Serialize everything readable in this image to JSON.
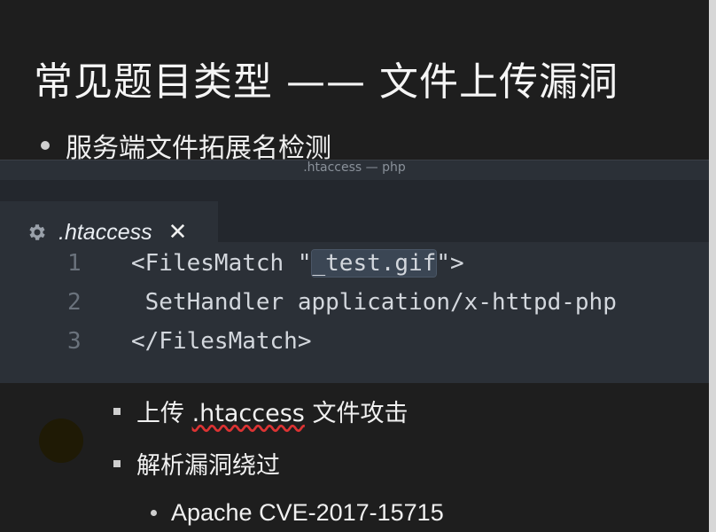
{
  "slide": {
    "title": "常见题目类型 —— 文件上传漏洞",
    "bullet1": "服务端文件拓展名检测"
  },
  "editor": {
    "window_title": ".htaccess — php",
    "tab": {
      "label": ".htaccess",
      "icon": "gear-icon",
      "close": "✕"
    },
    "lines": [
      {
        "num": "1",
        "pre": "<FilesMatch \"",
        "highlight": "_test.gif",
        "post": "\">"
      },
      {
        "num": "2",
        "text": " SetHandler application/x-httpd-php"
      },
      {
        "num": "3",
        "text": "</FilesMatch>"
      }
    ]
  },
  "sub_bullets": [
    {
      "prefix": "上传 ",
      "highlight": ".htaccess",
      "suffix": " 文件攻击"
    },
    {
      "text": "解析漏洞绕过"
    }
  ],
  "sub_sub_bullets": [
    {
      "text": "Apache CVE-2017-15715"
    }
  ],
  "colors": {
    "background": "#1e1e1e",
    "editor_bg": "#2b3037",
    "tabbar_bg": "#23272d",
    "selection": "#3b4654",
    "line_number": "#6a727c"
  }
}
